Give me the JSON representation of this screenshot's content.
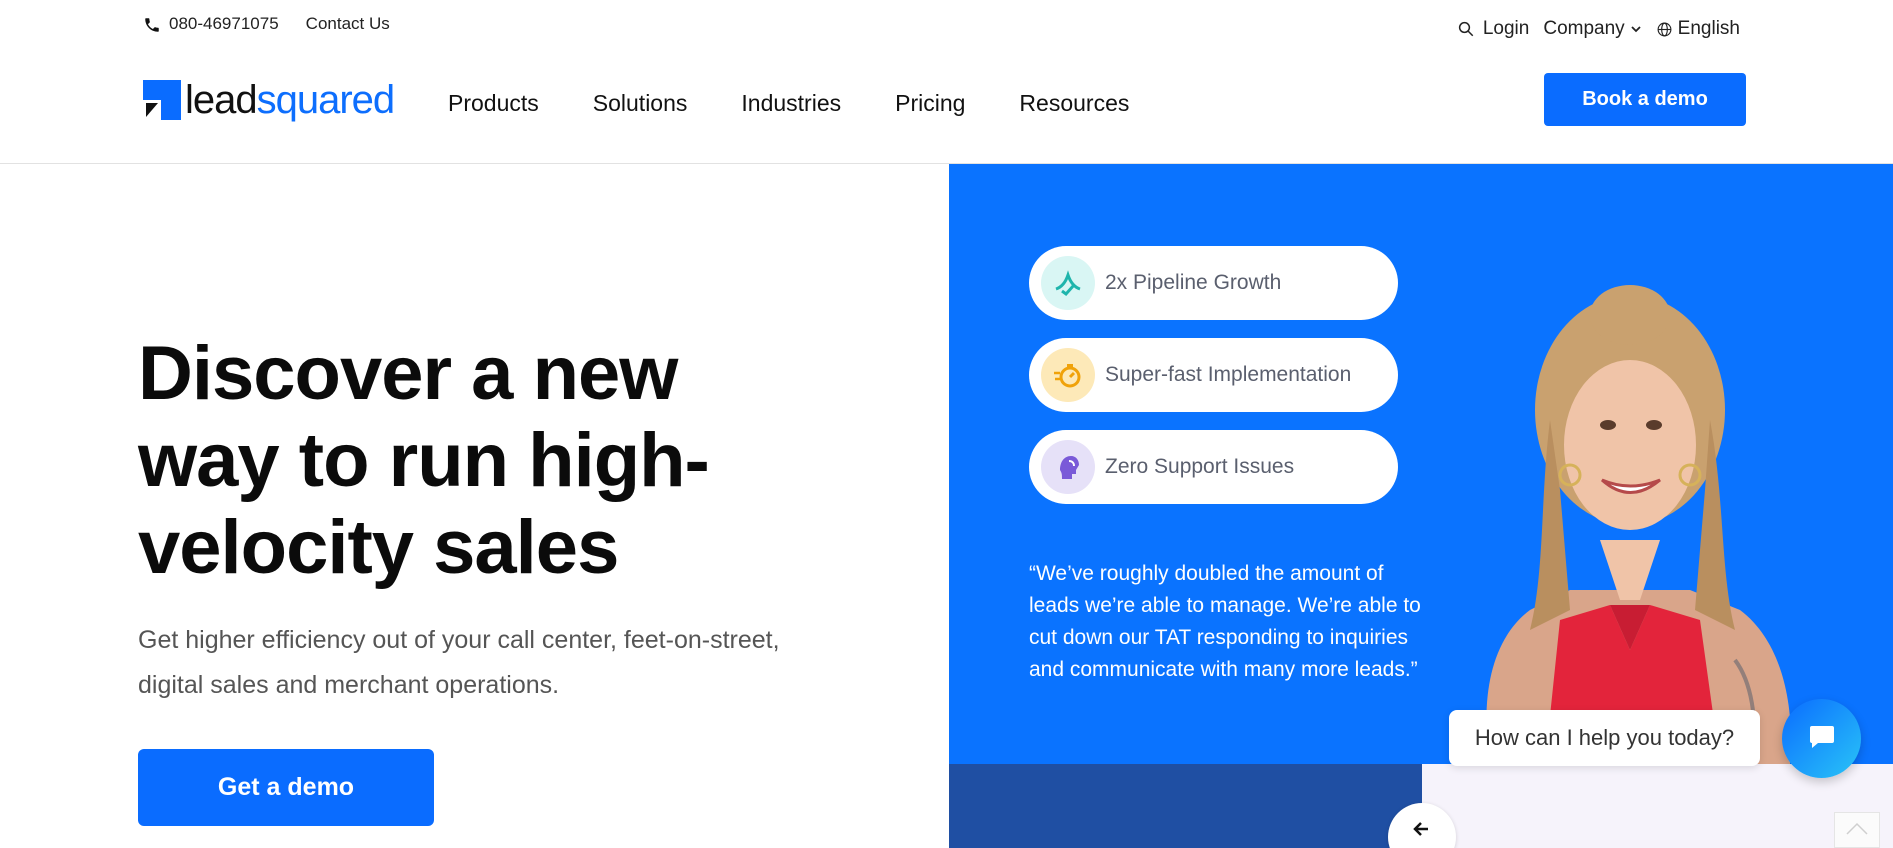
{
  "topbar": {
    "phone": "080-46971075",
    "contact_label": "Contact Us",
    "login_label": "Login",
    "company_label": "Company",
    "language_label": "English"
  },
  "header": {
    "logo_lead": "lead",
    "logo_squared": "squared",
    "nav": [
      "Products",
      "Solutions",
      "Industries",
      "Pricing",
      "Resources"
    ],
    "book_demo_label": "Book a demo"
  },
  "hero": {
    "title": "Discover a new way to run high-velocity sales",
    "subtitle": "Get higher efficiency out of your call center, feet-on-street, digital sales and merchant operations.",
    "cta_label": "Get a demo"
  },
  "highlights": [
    {
      "label": "2x Pipeline Growth",
      "icon": "growth-icon"
    },
    {
      "label": "Super-fast Implementation",
      "icon": "stopwatch-icon"
    },
    {
      "label": "Zero Support Issues",
      "icon": "support-headset-icon"
    }
  ],
  "testimonial": {
    "quote": "“We’ve roughly doubled the amount of leads we’re able to manage. We’re able to cut down our TAT responding to inquiries and communicate with many more leads.”"
  },
  "chat": {
    "prompt": "How can I help you today?"
  },
  "colors": {
    "accent": "#0a6cff",
    "panel_blue": "#0a73ff",
    "panel_dark": "#1f4fa3"
  }
}
